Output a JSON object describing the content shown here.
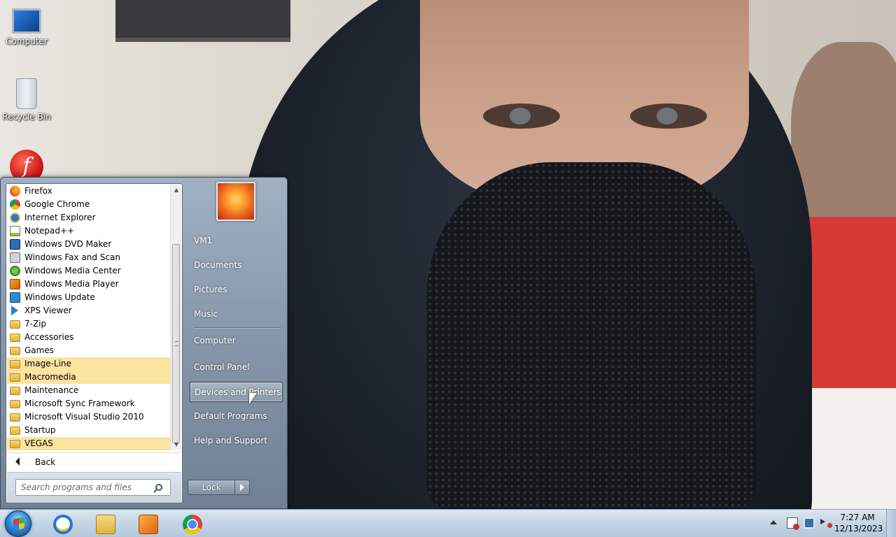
{
  "desktop": {
    "icons": [
      {
        "label": "Computer",
        "icon": "computer-icon"
      },
      {
        "label": "Recycle Bin",
        "icon": "recycle-bin-icon"
      },
      {
        "label": "",
        "icon": "adobe-flash-icon"
      }
    ]
  },
  "start_menu": {
    "programs": [
      {
        "label": "Firefox",
        "icon": "firefox-icon",
        "highlighted": false
      },
      {
        "label": "Google Chrome",
        "icon": "chrome-icon",
        "highlighted": false
      },
      {
        "label": "Internet Explorer",
        "icon": "internet-explorer-icon",
        "highlighted": false
      },
      {
        "label": "Notepad++",
        "icon": "notepad-plus-plus-icon",
        "highlighted": false
      },
      {
        "label": "Windows DVD Maker",
        "icon": "dvd-maker-icon",
        "highlighted": false
      },
      {
        "label": "Windows Fax and Scan",
        "icon": "fax-scan-icon",
        "highlighted": false
      },
      {
        "label": "Windows Media Center",
        "icon": "media-center-icon",
        "highlighted": false
      },
      {
        "label": "Windows Media Player",
        "icon": "media-player-icon",
        "highlighted": false
      },
      {
        "label": "Windows Update",
        "icon": "windows-update-icon",
        "highlighted": false
      },
      {
        "label": "XPS Viewer",
        "icon": "xps-viewer-icon",
        "highlighted": false
      },
      {
        "label": "7-Zip",
        "icon": "folder-icon",
        "highlighted": false
      },
      {
        "label": "Accessories",
        "icon": "folder-icon",
        "highlighted": false
      },
      {
        "label": "Games",
        "icon": "folder-icon",
        "highlighted": false
      },
      {
        "label": "Image-Line",
        "icon": "folder-icon",
        "highlighted": true
      },
      {
        "label": "Macromedia",
        "icon": "folder-icon",
        "highlighted": true
      },
      {
        "label": "Maintenance",
        "icon": "folder-icon",
        "highlighted": false
      },
      {
        "label": "Microsoft Sync Framework",
        "icon": "folder-icon",
        "highlighted": false
      },
      {
        "label": "Microsoft Visual Studio 2010",
        "icon": "folder-icon",
        "highlighted": false
      },
      {
        "label": "Startup",
        "icon": "folder-icon",
        "highlighted": false
      },
      {
        "label": "VEGAS",
        "icon": "folder-icon",
        "highlighted": true
      }
    ],
    "back_label": "Back",
    "search_placeholder": "Search programs and files",
    "user_picture": "user-picture-flower",
    "right_items": [
      {
        "label": "VM1"
      },
      {
        "label": "Documents"
      },
      {
        "label": "Pictures"
      },
      {
        "label": "Music"
      },
      {
        "label": "Computer"
      },
      {
        "label": "Control Panel"
      },
      {
        "label": "Devices and Printers",
        "selected": true
      },
      {
        "label": "Default Programs"
      },
      {
        "label": "Help and Support"
      }
    ],
    "lock_label": "Lock"
  },
  "taskbar": {
    "pinned": [
      {
        "icon": "internet-explorer-icon"
      },
      {
        "icon": "windows-explorer-icon"
      },
      {
        "icon": "windows-media-player-icon"
      },
      {
        "icon": "google-chrome-icon"
      }
    ],
    "clock": {
      "time": "7:27 AM",
      "date": "12/13/2023"
    }
  },
  "colors": {
    "start_menu_highlight": "#fbe3a0",
    "start_menu_glass": "#8496a8",
    "taskbar": "#c3d4e4"
  }
}
